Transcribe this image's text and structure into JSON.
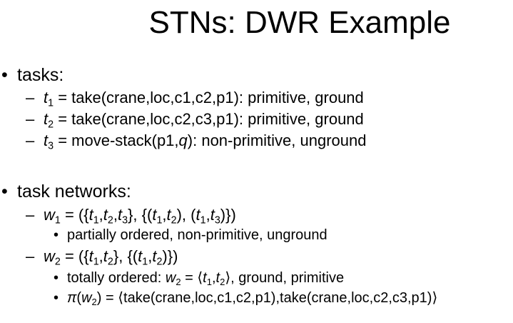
{
  "slide": {
    "title": "STNs: DWR Example"
  },
  "bullets": {
    "level1": "•",
    "level2": "–",
    "level3": "•"
  },
  "tasks": {
    "heading": "tasks:",
    "items": [
      {
        "var": "t",
        "sub": "1",
        "rest": " = take(crane,loc,c1,c2,p1): primitive, ground"
      },
      {
        "var": "t",
        "sub": "2",
        "rest": " = take(crane,loc,c2,c3,p1): primitive, ground"
      },
      {
        "var": "t",
        "sub": "3",
        "rest_before_q": " = move-stack(p1,",
        "q": "q",
        "rest_after_q": "): non-primitive, unground"
      }
    ]
  },
  "networks": {
    "heading": "task networks:",
    "w1": {
      "formula": "w1 = ({t1,t2,t3}, {(t1,t2), (t1,t3)})",
      "note": "partially ordered, non-primitive, unground"
    },
    "w2": {
      "formula": "w2 = ({t1,t2}, {(t1,t2)})",
      "note_prefix": "totally ordered: ",
      "note_suffix": ", ground, primitive",
      "plan_suffix": " = ⟨take(crane,loc,c1,c2,p1),take(crane,loc,c2,c3,p1)⟩"
    }
  }
}
